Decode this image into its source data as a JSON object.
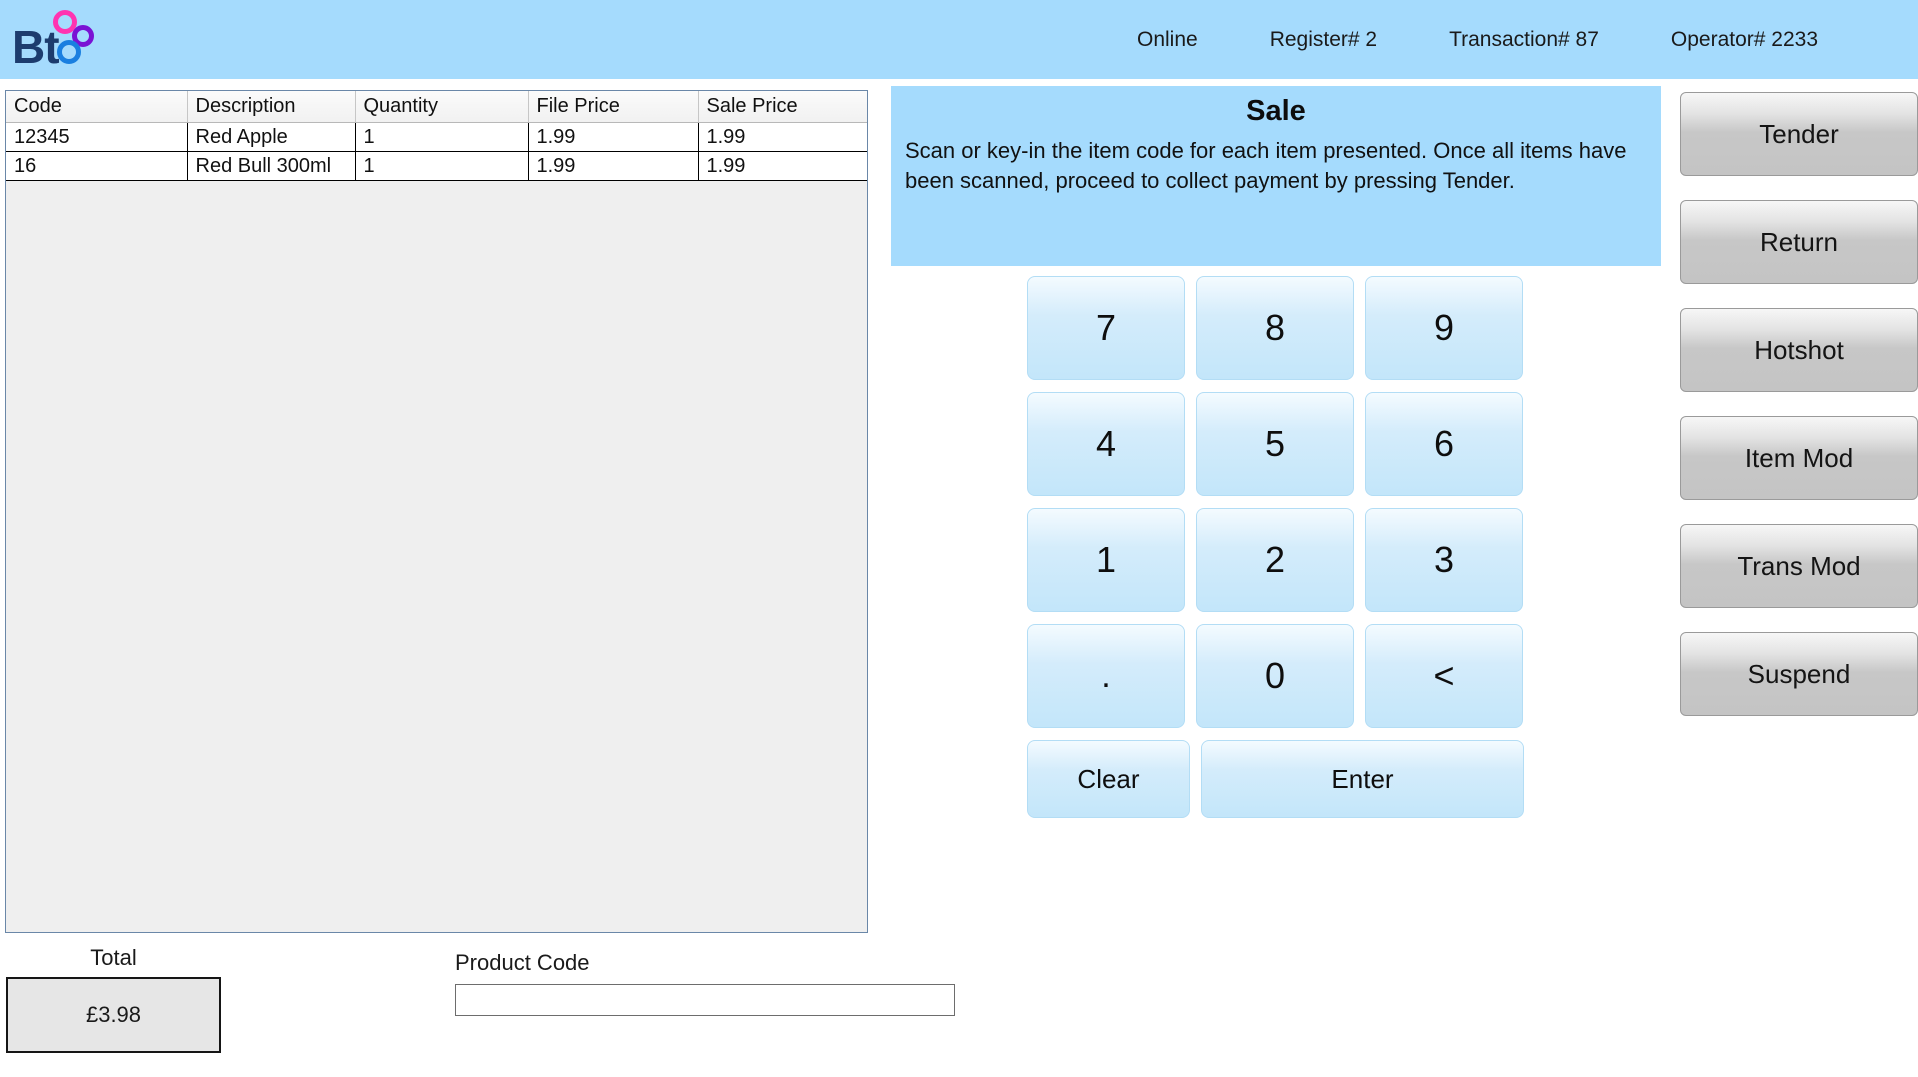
{
  "header": {
    "logo_text": "Bt",
    "status": {
      "online": "Online",
      "register": "Register# 2",
      "transaction": "Transaction# 87",
      "operator": "Operator# 2233"
    }
  },
  "item_list": {
    "columns": [
      "Code",
      "Description",
      "Quantity",
      "File Price",
      "Sale Price"
    ],
    "rows": [
      {
        "code": "12345",
        "description": "Red Apple",
        "quantity": "1",
        "file_price": "1.99",
        "sale_price": "1.99"
      },
      {
        "code": "16",
        "description": "Red Bull 300ml",
        "quantity": "1",
        "file_price": "1.99",
        "sale_price": "1.99"
      }
    ]
  },
  "totals": {
    "label": "Total",
    "value": "£3.98"
  },
  "product_code": {
    "label": "Product Code",
    "value": "",
    "placeholder": ""
  },
  "sale_panel": {
    "title": "Sale",
    "body": "Scan or key-in the item code for each item presented. Once all items have been scanned, proceed to collect payment by pressing Tender."
  },
  "keypad": {
    "rows": [
      [
        "7",
        "8",
        "9"
      ],
      [
        "4",
        "5",
        "6"
      ],
      [
        "1",
        "2",
        "3"
      ],
      [
        ".",
        "0",
        "<"
      ]
    ],
    "clear_label": "Clear",
    "enter_label": "Enter"
  },
  "side_buttons": [
    {
      "label": "Tender"
    },
    {
      "label": "Return"
    },
    {
      "label": "Hotshot"
    },
    {
      "label": "Item Mod"
    },
    {
      "label": "Trans Mod"
    },
    {
      "label": "Suspend"
    }
  ],
  "colors": {
    "header_blue": "#a5dbfd",
    "panel_blue": "#a5dbfd",
    "key_blue": "#c3e6fa",
    "list_bg": "#efefef",
    "logo_navy": "#1d3c6e",
    "logo_pink": "#ff33b1",
    "logo_purple": "#7a12d4",
    "logo_blue": "#1a7fe0"
  }
}
